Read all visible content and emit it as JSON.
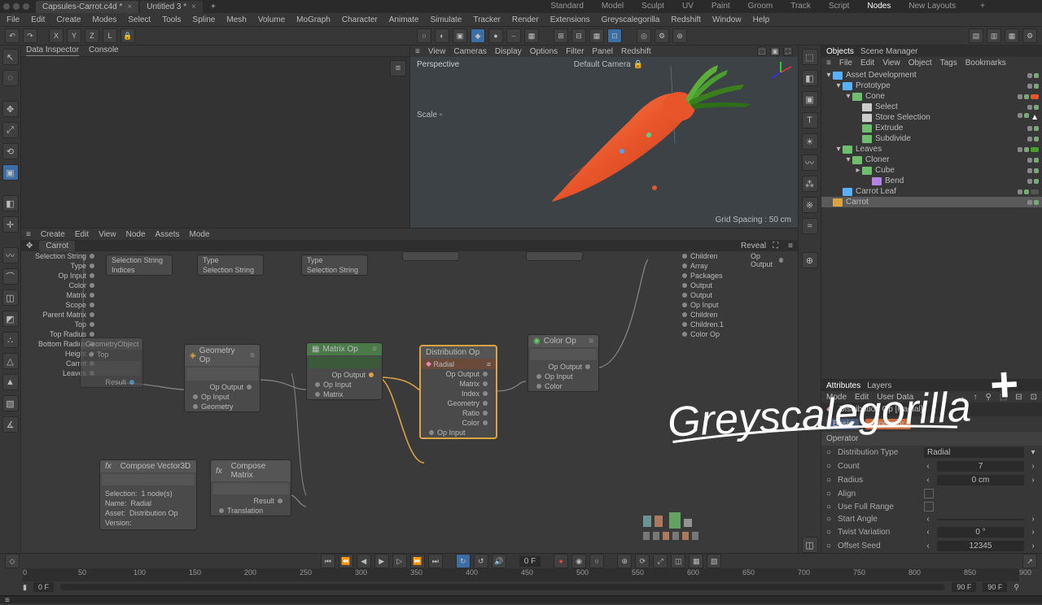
{
  "title": {
    "tab1": "Capsules-Carrot.c4d *",
    "tab2": "Untitled 3 *"
  },
  "topmodes": [
    "Standard",
    "Model",
    "Sculpt",
    "UV",
    "Paint",
    "Groom",
    "Track",
    "Script",
    "Nodes",
    "New Layouts"
  ],
  "topmodes_sel": "Nodes",
  "menubar": [
    "File",
    "Edit",
    "Create",
    "Modes",
    "Select",
    "Tools",
    "Spline",
    "Mesh",
    "Volume",
    "MoGraph",
    "Character",
    "Animate",
    "Simulate",
    "Tracker",
    "Render",
    "Extensions",
    "Greyscalegorilla",
    "Redshift",
    "Window",
    "Help"
  ],
  "axes": [
    "X",
    "Y",
    "Z",
    "L"
  ],
  "datainsp_tabs": [
    "Data Inspector",
    "Console"
  ],
  "vp_menu": [
    "View",
    "Cameras",
    "Display",
    "Options",
    "Filter",
    "Panel",
    "Redshift"
  ],
  "vp": {
    "persp": "Perspective",
    "scale": "Scale",
    "cam": "Default Camera",
    "grid": "Grid Spacing : 50 cm"
  },
  "na_menu": [
    "Create",
    "Edit",
    "View",
    "Node",
    "Assets",
    "Mode"
  ],
  "na_path": "Carrot",
  "na_reveal": "Reveal",
  "nodes": {
    "left_ports": [
      "Selection String",
      "Type",
      "Op Input",
      "Color",
      "Matrix",
      "Scope",
      "Parent Matrix",
      "Top",
      "Top Radius",
      "Bottom Radius",
      "Height",
      "Carrot",
      "Leaves"
    ],
    "indices": "Indices",
    "type": "Type",
    "selstr": "Selection String",
    "geoobj_title": "GeometryObject",
    "geoobj_sub": "Top",
    "geoobj_result": "Result",
    "geoop_title": "Geometry Op",
    "geoop_out": "Op Output",
    "geoop_in": "Op Input",
    "geoop_geo": "Geometry",
    "matop_title": "Matrix Op",
    "matop_out": "Op Output",
    "matop_in": "Op Input",
    "matop_mat": "Matrix",
    "distop_title": "Distribution Op",
    "distop_sub": "Radial",
    "distop_out": "Op Output",
    "distop_matrix": "Matrix",
    "distop_index": "Index",
    "distop_geo": "Geometry",
    "distop_ratio": "Ratio",
    "distop_color": "Color",
    "distop_in": "Op Input",
    "colorop_title": "Color Op",
    "colorop_out": "Op Output",
    "colorop_in": "Op Input",
    "colorop_col": "Color",
    "right_ports": [
      "Children",
      "Array",
      "Packages",
      "Output",
      "Output",
      "Op Input",
      "Children",
      "Children.1",
      "Color Op"
    ],
    "opout": "Op Output",
    "compv_title": "Compose Vector3D",
    "compm_title": "Compose Matrix",
    "compm_res": "Result",
    "compm_trans": "Translation",
    "sel": "Selection:",
    "selv": "1 node(s)",
    "name": "Name:",
    "namev": "Radial",
    "asset": "Asset:",
    "assetv": "Distribution Op",
    "ver": "Version:"
  },
  "obj_tabs": [
    "Objects",
    "Scene Manager"
  ],
  "obj_menu": [
    "File",
    "Edit",
    "View",
    "Object",
    "Tags",
    "Bookmarks"
  ],
  "tree": [
    {
      "ind": 0,
      "tw": "▾",
      "ic": "#5ab0ff",
      "nm": "Asset Development"
    },
    {
      "ind": 1,
      "tw": "▾",
      "ic": "#5ab0ff",
      "nm": "Prototype"
    },
    {
      "ind": 2,
      "tw": "▾",
      "ic": "#6fbd6f",
      "nm": "Cone",
      "extra": "orange"
    },
    {
      "ind": 3,
      "tw": "",
      "ic": "#ccc",
      "nm": "Select"
    },
    {
      "ind": 3,
      "tw": "",
      "ic": "#ccc",
      "nm": "Store Selection",
      "extra": "tri"
    },
    {
      "ind": 3,
      "tw": "",
      "ic": "#6fbd6f",
      "nm": "Extrude"
    },
    {
      "ind": 3,
      "tw": "",
      "ic": "#6fbd6f",
      "nm": "Subdivide"
    },
    {
      "ind": 1,
      "tw": "▾",
      "ic": "#6fbd6f",
      "nm": "Leaves",
      "extra": "green"
    },
    {
      "ind": 2,
      "tw": "▾",
      "ic": "#6fbd6f",
      "nm": "Cloner"
    },
    {
      "ind": 3,
      "tw": "▸",
      "ic": "#6fbd6f",
      "nm": "Cube"
    },
    {
      "ind": 4,
      "tw": "",
      "ic": "#b084e0",
      "nm": "Bend"
    },
    {
      "ind": 1,
      "tw": "",
      "ic": "#5ab0ff",
      "nm": "Carrot Leaf",
      "extra": "leaf"
    },
    {
      "ind": 0,
      "tw": "",
      "ic": "#d9a441",
      "nm": "Carrot",
      "sel": true
    }
  ],
  "attr_tabs": [
    "Attributes",
    "Layers"
  ],
  "attr_menu": [
    "Mode",
    "Edit",
    "User Data"
  ],
  "attr_title": "Distribution Op [Radial]",
  "attr_sub": [
    "Basic",
    "Operator"
  ],
  "attr_group": "Operator",
  "attrs": [
    {
      "lbl": "Distribution Type",
      "val": "Radial",
      "type": "drop"
    },
    {
      "lbl": "Count",
      "val": "7"
    },
    {
      "lbl": "Radius",
      "val": "0 cm"
    },
    {
      "lbl": "Align",
      "val": "",
      "type": "check"
    },
    {
      "lbl": "Use Full Range",
      "val": "",
      "type": "check"
    },
    {
      "lbl": "Start Angle",
      "val": ""
    },
    {
      "lbl": "Twist Variation",
      "val": "0 °"
    },
    {
      "lbl": "Offset Seed",
      "val": "12345"
    }
  ],
  "tl": {
    "cur": "0 F",
    "ticks": [
      0,
      50,
      100,
      150,
      200,
      250,
      300,
      350,
      400,
      450,
      500,
      550,
      600,
      650,
      700,
      750,
      800,
      850,
      900
    ],
    "start": "0 F",
    "end": "90 F",
    "end2": "90 F"
  },
  "logo": "Greyscalegorilla"
}
